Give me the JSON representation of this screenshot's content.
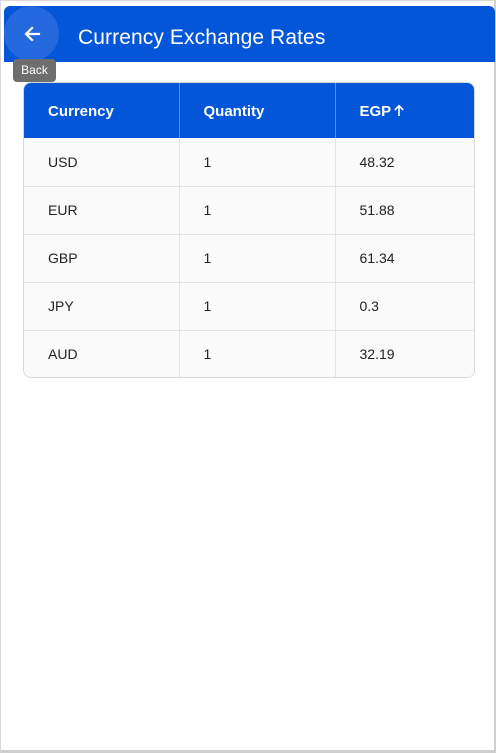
{
  "app_bar": {
    "title": "Currency Exchange Rates",
    "back_tooltip": "Back",
    "color": "#0356d8",
    "back_icon": "arrow-left-icon"
  },
  "table": {
    "headers": {
      "currency": "Currency",
      "quantity": "Quantity",
      "egp": "EGP"
    },
    "sort": {
      "column": "EGP",
      "direction": "ascending",
      "icon": "arrow-up-icon"
    },
    "rows": [
      {
        "currency": "USD",
        "quantity": "1",
        "egp": "48.32"
      },
      {
        "currency": "EUR",
        "quantity": "1",
        "egp": "51.88"
      },
      {
        "currency": "GBP",
        "quantity": "1",
        "egp": "61.34"
      },
      {
        "currency": "JPY",
        "quantity": "1",
        "egp": "0.3"
      },
      {
        "currency": "AUD",
        "quantity": "1",
        "egp": "32.19"
      }
    ]
  }
}
